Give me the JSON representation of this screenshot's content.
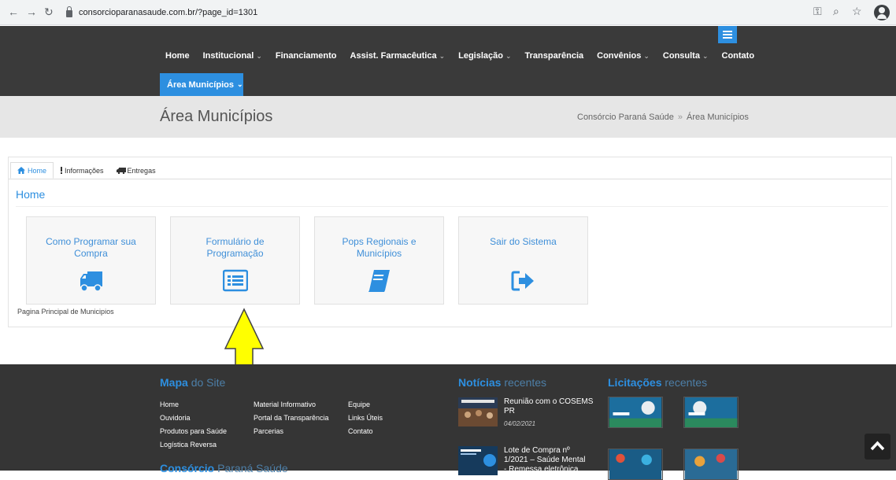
{
  "browser": {
    "url": "consorcioparanasaude.com.br/?page_id=1301"
  },
  "nav": {
    "items": [
      {
        "label": "Home",
        "dropdown": false
      },
      {
        "label": "Institucional",
        "dropdown": true
      },
      {
        "label": "Financiamento",
        "dropdown": false
      },
      {
        "label": "Assist. Farmacêutica",
        "dropdown": true
      },
      {
        "label": "Legislação",
        "dropdown": true
      },
      {
        "label": "Transparência",
        "dropdown": false
      },
      {
        "label": "Convênios",
        "dropdown": true
      },
      {
        "label": "Consulta",
        "dropdown": true
      },
      {
        "label": "Contato",
        "dropdown": false
      }
    ],
    "area_button": "Área Municípios",
    "caret": "⌄"
  },
  "header": {
    "title": "Área Municípios",
    "breadcrumb": {
      "root": "Consórcio Paraná Saúde",
      "sep": "»",
      "current": "Área Municípios"
    }
  },
  "panel": {
    "tabs": [
      "Home",
      "Informações",
      "Entregas"
    ],
    "section_title": "Home",
    "cards": [
      {
        "label": "Como Programar sua Compra",
        "icon": "truck-icon"
      },
      {
        "label": "Formulário de Programação",
        "icon": "list-icon"
      },
      {
        "label": "Pops Regionais e Municípios",
        "icon": "book-icon"
      },
      {
        "label": "Sair do Sistema",
        "icon": "sign-out-icon"
      }
    ],
    "note": "Pagina Principal de Municipios"
  },
  "footer": {
    "mapa": {
      "heading_bold": "Mapa",
      "heading_light": "do Site"
    },
    "links_col1": [
      "Home",
      "Ouvidoria",
      "Produtos para Saúde",
      "Logística Reversa"
    ],
    "links_col2": [
      "Material Informativo",
      "Portal da Transparência",
      "Parcerias"
    ],
    "links_col3": [
      "Equipe",
      "Links Úteis",
      "Contato"
    ],
    "consorcio": {
      "heading_bold": "Consórcio",
      "heading_light": "Paraná Saúde"
    },
    "noticias": {
      "heading_bold": "Notícias",
      "heading_light": "recentes"
    },
    "news": [
      {
        "title_line1": "Reunião com o COSEMS",
        "title_line2": "PR",
        "date": "04/02/2021"
      },
      {
        "title_line1": "Lote de Compra nº",
        "title_line2": "1/2021 – Saúde Mental",
        "title_line3": "- Remessa eletrônica"
      }
    ],
    "licitacoes": {
      "heading_bold": "Licitações",
      "heading_light": "recentes"
    }
  },
  "colors": {
    "accent": "#2d8fe0",
    "nav_bg": "#3a3a3a",
    "footer_bg": "#353535",
    "arrow": "#ffff00"
  }
}
